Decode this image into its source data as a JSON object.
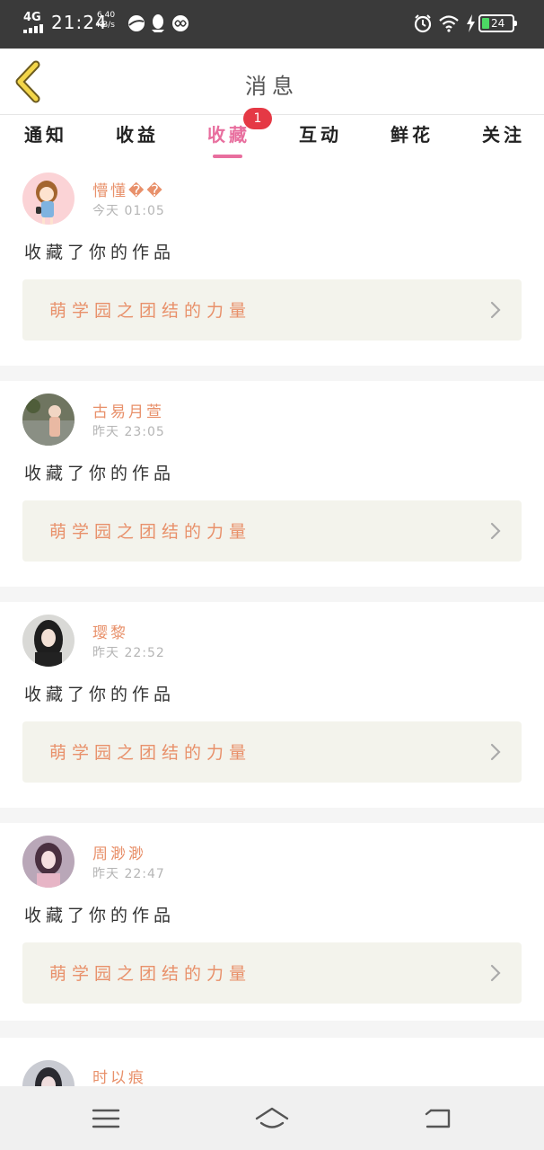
{
  "status_bar": {
    "network": "4G",
    "time": "21:24",
    "speed_value": "6.40",
    "speed_unit": "KB/s",
    "battery": "24",
    "icons": [
      "browser-icon",
      "qq-icon",
      "infinity-icon",
      "alarm-icon",
      "wifi-icon",
      "charging-icon",
      "battery-icon"
    ]
  },
  "header": {
    "title": "消息",
    "back_icon": "chevron-left-icon"
  },
  "tabs": [
    {
      "label": "通知"
    },
    {
      "label": "收益"
    },
    {
      "label": "收藏",
      "active": true,
      "badge": "1"
    },
    {
      "label": "互动"
    },
    {
      "label": "鲜花"
    },
    {
      "label": "关注"
    }
  ],
  "notifications": [
    {
      "username": "懵懂��",
      "time": "今天 01:05",
      "action": "收藏了你的作品",
      "work_title": "萌学园之团结的力量"
    },
    {
      "username": "古易月萱",
      "time": "昨天 23:05",
      "action": "收藏了你的作品",
      "work_title": "萌学园之团结的力量"
    },
    {
      "username": "璎黎",
      "time": "昨天 22:52",
      "action": "收藏了你的作品",
      "work_title": "萌学园之团结的力量"
    },
    {
      "username": "周渺渺",
      "time": "昨天 22:47",
      "action": "收藏了你的作品",
      "work_title": "萌学园之团结的力量"
    },
    {
      "username": "时以痕"
    }
  ],
  "colors": {
    "accent": "#e86e9e",
    "username": "#e8906a",
    "badge": "#e53945",
    "status_bar_bg": "#3a3a3a"
  },
  "nav_bar": [
    "menu-icon",
    "home-icon",
    "back-icon"
  ]
}
